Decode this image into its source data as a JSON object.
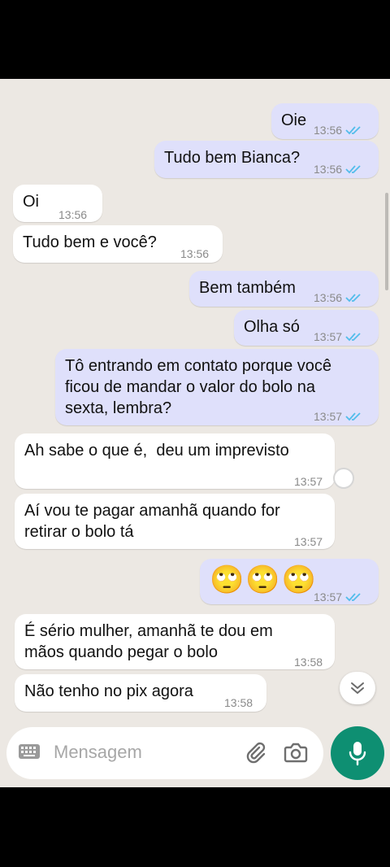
{
  "composer": {
    "placeholder": "Mensagem"
  },
  "messages": [
    {
      "id": "m1",
      "direction": "out",
      "text": "Oie",
      "time": "13:56",
      "read": true
    },
    {
      "id": "m2",
      "direction": "out",
      "text": "Tudo bem Bianca?",
      "time": "13:56",
      "read": true
    },
    {
      "id": "m3",
      "direction": "in",
      "text": "Oi",
      "time": "13:56"
    },
    {
      "id": "m4",
      "direction": "in",
      "text": "Tudo bem e você?",
      "time": "13:56"
    },
    {
      "id": "m5",
      "direction": "out",
      "text": "Bem também",
      "time": "13:56",
      "read": true
    },
    {
      "id": "m6",
      "direction": "out",
      "text": "Olha só",
      "time": "13:57",
      "read": true
    },
    {
      "id": "m7",
      "direction": "out",
      "text": "Tô entrando em contato porque você\nficou de mandar o valor do bolo na\nsexta, lembra?",
      "time": "13:57",
      "read": true
    },
    {
      "id": "m8",
      "direction": "in",
      "text": "Ah sabe o que é,  deu um imprevisto",
      "time": "13:57"
    },
    {
      "id": "m9",
      "direction": "in",
      "text": "Aí vou te pagar amanhã quando for\nretirar o bolo tá",
      "time": "13:57"
    },
    {
      "id": "m10",
      "direction": "out",
      "text": "🙄🙄🙄",
      "time": "13:57",
      "read": true
    },
    {
      "id": "m11",
      "direction": "in",
      "text": "É sério mulher, amanhã te dou em\nmãos quando pegar o bolo",
      "time": "13:58"
    },
    {
      "id": "m12",
      "direction": "in",
      "text": "Não tenho no pix agora",
      "time": "13:58"
    }
  ],
  "colors": {
    "outgoing_bubble": "#dfe0fb",
    "incoming_bubble": "#ffffff",
    "chat_background": "#ece8e3",
    "read_ticks": "#53bdeb",
    "mic_button": "#0e8f72"
  },
  "icons": {
    "keyboard": "keyboard-icon",
    "attach": "paperclip-icon",
    "camera": "camera-icon",
    "mic": "microphone-icon",
    "scroll_down": "double-chevron-down-icon",
    "read_receipt": "double-check-icon"
  }
}
